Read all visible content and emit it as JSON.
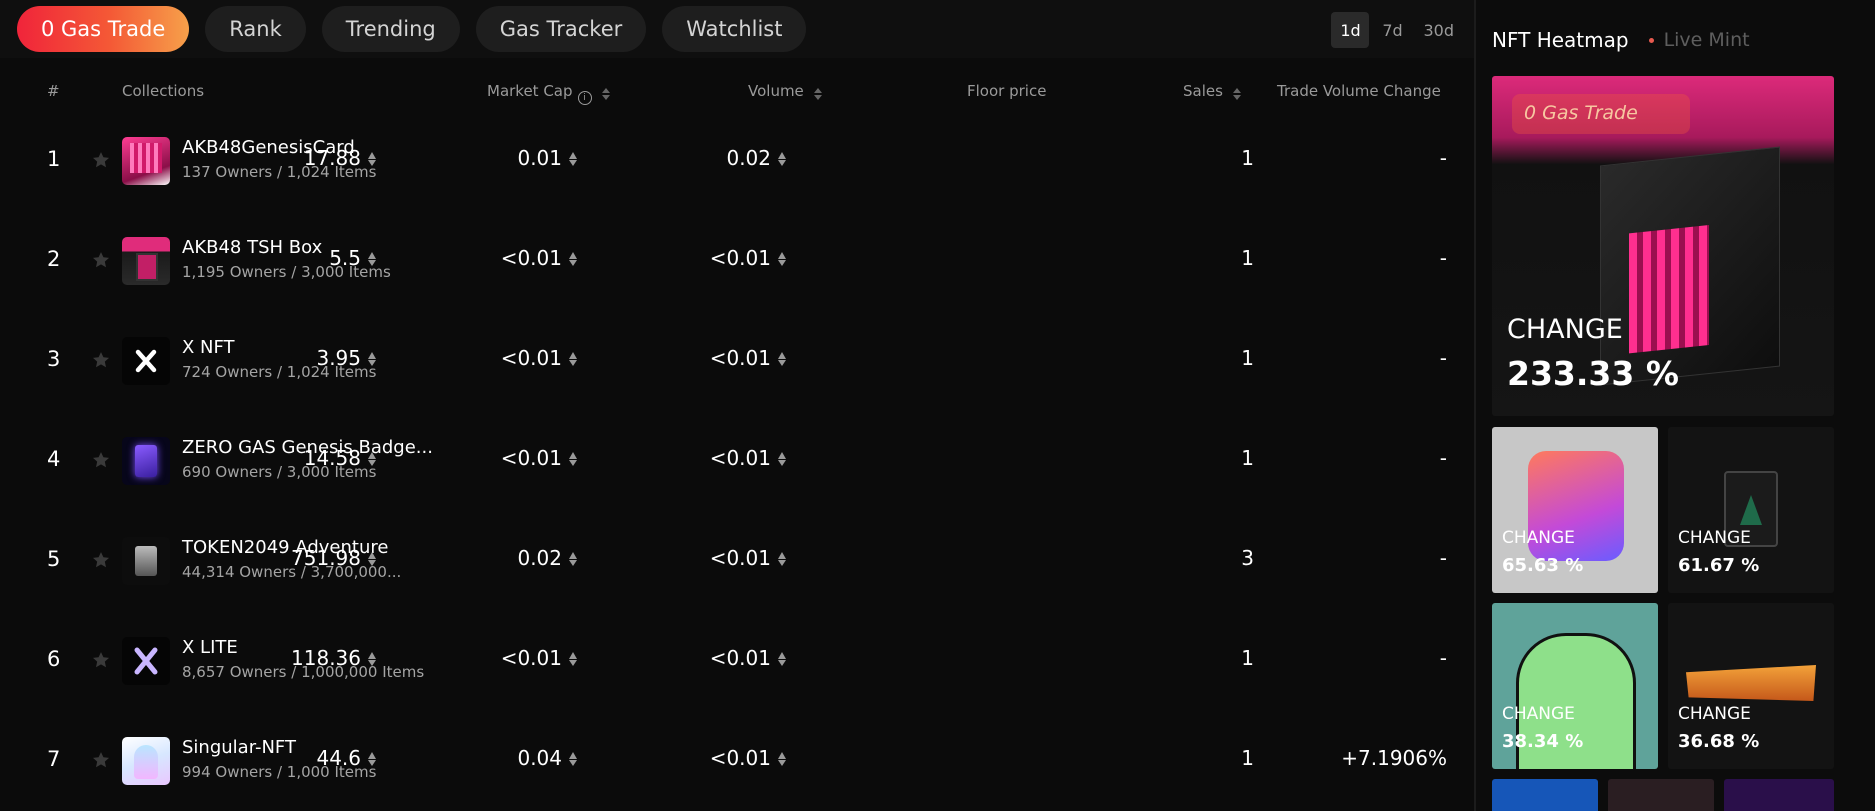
{
  "nav": {
    "tabs": [
      "0 Gas Trade",
      "Rank",
      "Trending",
      "Gas Tracker",
      "Watchlist"
    ],
    "active_tab": "0 Gas Trade",
    "ranges": [
      "1d",
      "7d",
      "30d"
    ],
    "selected_range": "1d"
  },
  "table": {
    "headers": {
      "rank": "#",
      "collections": "Collections",
      "market_cap": "Market Cap",
      "volume": "Volume",
      "floor_price": "Floor price",
      "sales": "Sales",
      "trade_volume_change": "Trade Volume Change"
    },
    "rows": [
      {
        "rank": "1",
        "name": "AKB48GenesisCard",
        "sub": "137 Owners / 1,024 Items",
        "market_cap": "17.88",
        "volume": "0.01",
        "floor_price": "0.02",
        "sales": "1",
        "change": "-",
        "change_positive": false
      },
      {
        "rank": "2",
        "name": "AKB48 TSH Box",
        "sub": "1,195 Owners / 3,000 Items",
        "market_cap": "5.5",
        "volume": "<0.01",
        "floor_price": "<0.01",
        "sales": "1",
        "change": "-",
        "change_positive": false
      },
      {
        "rank": "3",
        "name": "X NFT",
        "sub": "724 Owners / 1,024 Items",
        "market_cap": "3.95",
        "volume": "<0.01",
        "floor_price": "<0.01",
        "sales": "1",
        "change": "-",
        "change_positive": false
      },
      {
        "rank": "4",
        "name": "ZERO GAS Genesis Badge...",
        "sub": "690 Owners / 3,000 Items",
        "market_cap": "14.58",
        "volume": "<0.01",
        "floor_price": "<0.01",
        "sales": "1",
        "change": "-",
        "change_positive": false
      },
      {
        "rank": "5",
        "name": "TOKEN2049 Adventure",
        "sub": "44,314 Owners / 3,700,000...",
        "market_cap": "751.98",
        "volume": "0.02",
        "floor_price": "<0.01",
        "sales": "3",
        "change": "-",
        "change_positive": false
      },
      {
        "rank": "6",
        "name": "X LITE",
        "sub": "8,657 Owners / 1,000,000 Items",
        "market_cap": "118.36",
        "volume": "<0.01",
        "floor_price": "<0.01",
        "sales": "1",
        "change": "-",
        "change_positive": false
      },
      {
        "rank": "7",
        "name": "Singular-NFT",
        "sub": "994 Owners / 1,000 Items",
        "market_cap": "44.6",
        "volume": "0.04",
        "floor_price": "<0.01",
        "sales": "1",
        "change": "+7.1906%",
        "change_positive": true
      }
    ]
  },
  "sidebar": {
    "title": "NFT Heatmap",
    "live_mint": "Live Mint",
    "tiles": [
      {
        "badge": "0 Gas Trade",
        "label": "CHANGE",
        "value": "233.33 %"
      },
      {
        "label": "CHANGE",
        "value": "65.63 %"
      },
      {
        "label": "CHANGE",
        "value": "61.67 %"
      },
      {
        "label": "CHANGE",
        "value": "38.34 %"
      },
      {
        "label": "CHANGE",
        "value": "36.68 %"
      }
    ]
  },
  "colors": {
    "accent_start": "#f0243a",
    "accent_end": "#f6a04a",
    "positive": "#4fbf66",
    "background": "#0b0b0b"
  },
  "icons": [
    "star-icon",
    "eth-icon",
    "sort-icon",
    "info-icon"
  ]
}
